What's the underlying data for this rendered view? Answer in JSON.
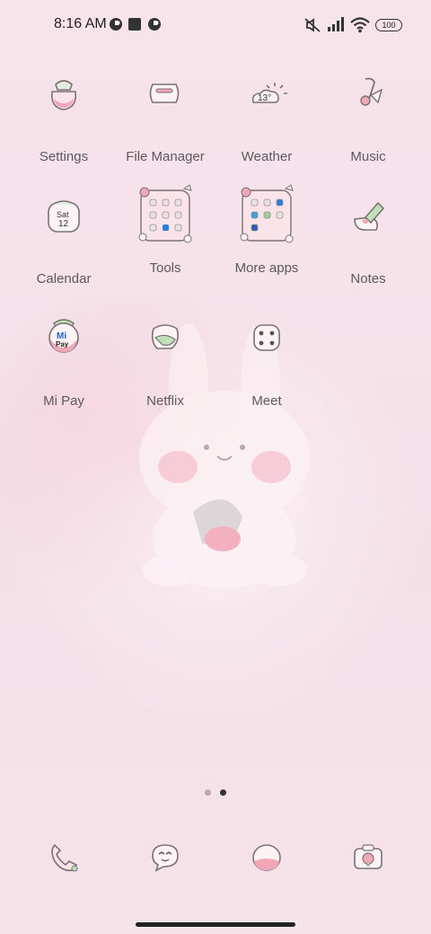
{
  "status_bar": {
    "time": "8:16 AM",
    "battery": "100",
    "left_icons": [
      "notification-icon",
      "square-icon",
      "notification-icon"
    ],
    "right_icons": [
      "mute-icon",
      "signal-icon",
      "wifi-icon",
      "battery-icon"
    ]
  },
  "apps": [
    {
      "label": "Settings",
      "icon": "settings-icon"
    },
    {
      "label": "File Manager",
      "icon": "file-manager-icon"
    },
    {
      "label": "Weather",
      "icon": "weather-icon",
      "icon_text": "13°"
    },
    {
      "label": "Music",
      "icon": "music-icon"
    },
    {
      "label": "Calendar",
      "icon": "calendar-icon",
      "icon_text": "Sat",
      "icon_text2": "12"
    },
    {
      "label": "Tools",
      "icon": "tools-folder-icon"
    },
    {
      "label": "More apps",
      "icon": "more-apps-folder-icon"
    },
    {
      "label": "Notes",
      "icon": "notes-icon"
    },
    {
      "label": "Mi Pay",
      "icon": "mi-pay-icon",
      "icon_text": "Mi",
      "icon_text2": "Pay"
    },
    {
      "label": "Netflix",
      "icon": "netflix-icon"
    },
    {
      "label": "Meet",
      "icon": "meet-icon"
    }
  ],
  "page_indicator": {
    "pages": 2,
    "active": 2
  },
  "dock": [
    {
      "icon": "phone-icon"
    },
    {
      "icon": "messages-icon"
    },
    {
      "icon": "browser-icon"
    },
    {
      "icon": "camera-icon"
    }
  ],
  "colors": {
    "background": "#f6e3ea",
    "label": "#5d5a5c",
    "accent": "#f2a7b8"
  }
}
